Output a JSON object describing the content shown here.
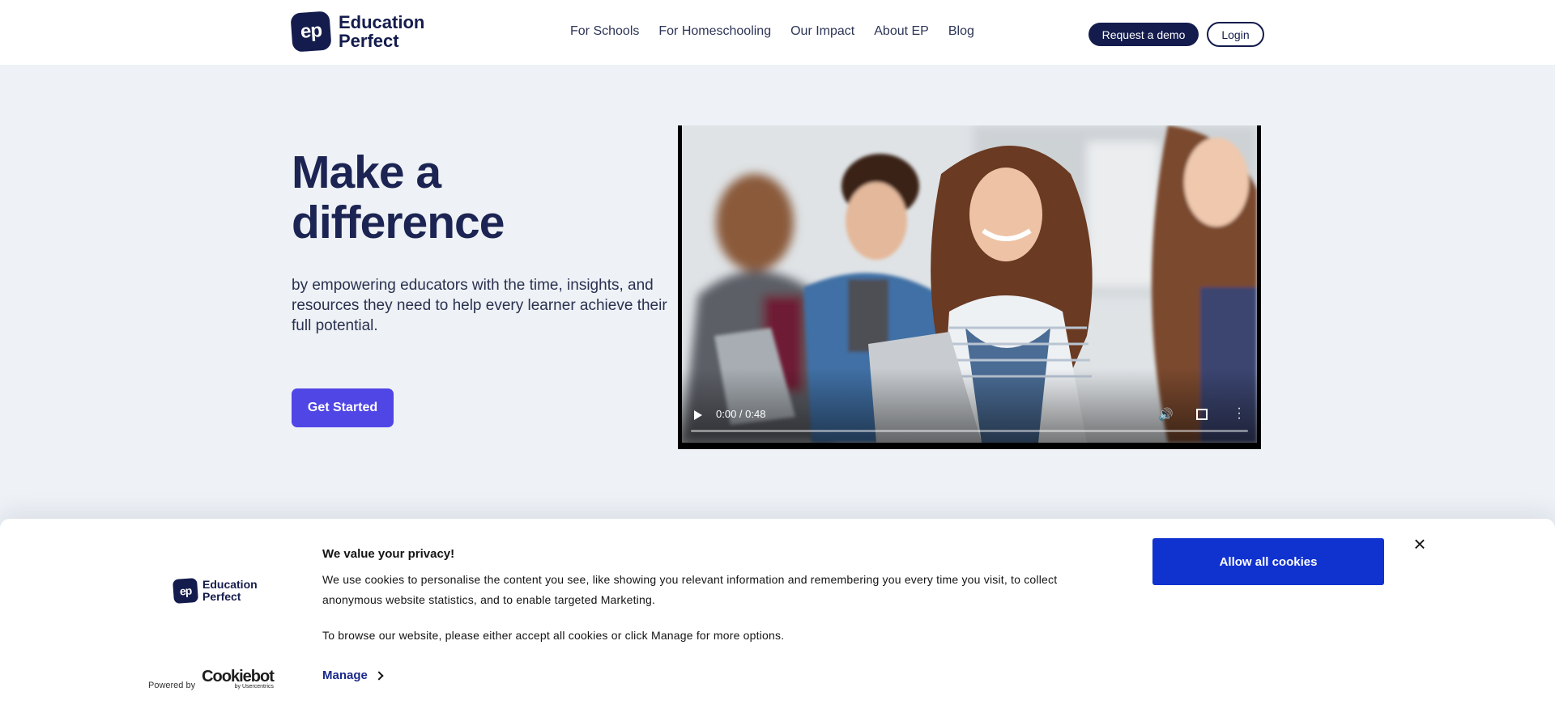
{
  "header": {
    "logo": {
      "mark": "ep",
      "line1": "Education",
      "line2": "Perfect"
    },
    "nav": [
      "For Schools",
      "For Homeschooling",
      "Our Impact",
      "About EP",
      "Blog"
    ],
    "request_demo": "Request a demo",
    "login": "Login"
  },
  "hero": {
    "title": "Make a difference",
    "subtitle": "by empowering educators with the time, insights, and resources they need to help every learner achieve their full potential.",
    "cta": "Get Started"
  },
  "video": {
    "time": "0:00 / 0:48",
    "icons": [
      "play-icon",
      "volume-icon",
      "fullscreen-icon",
      "more-options-icon"
    ]
  },
  "cookie": {
    "logo": {
      "mark": "ep",
      "line1": "Education",
      "line2": "Perfect"
    },
    "powered_by": "Powered by",
    "cookiebot": "Cookiebot",
    "cookiebot_sub": "by Usercentrics",
    "title": "We value your privacy!",
    "text": "We use cookies to personalise the content you see, like showing you relevant information and remembering you every time you visit, to collect anonymous website statistics, and to enable targeted Marketing.",
    "text2": "To browse our website, please either accept all cookies or click Manage for more options.",
    "manage": "Manage",
    "allow_all": "Allow all cookies",
    "close": "×"
  },
  "colors": {
    "brand_navy": "#141c4d",
    "cta_purple": "#5046e5",
    "cookie_blue": "#1032cf",
    "page_bg": "#eef2f6"
  }
}
